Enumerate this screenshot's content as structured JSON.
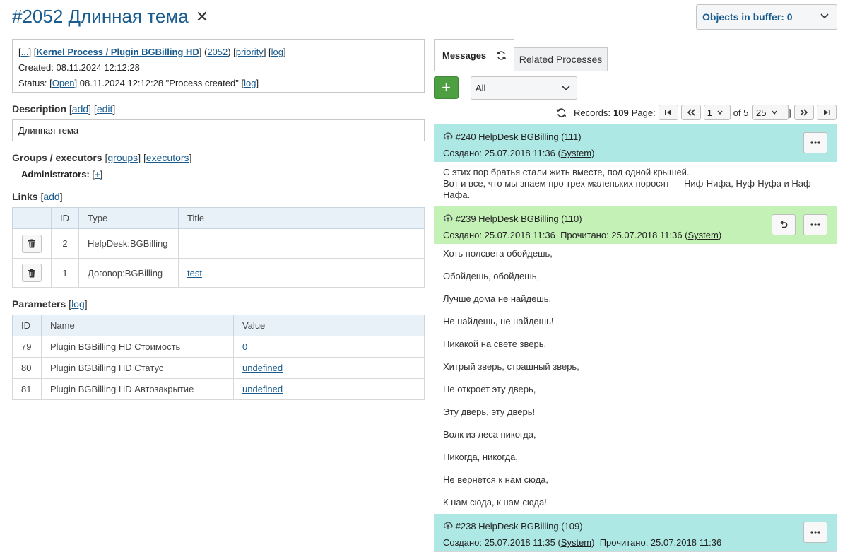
{
  "header": {
    "title": "#2052 Длинная тема",
    "close": "✕"
  },
  "buffer": {
    "label": "Objects in buffer:",
    "count": "0"
  },
  "info": {
    "ellipsis": "...",
    "kernel": "Kernel Process / Plugin BGBilling HD",
    "id_link": "2052",
    "priority": "priority",
    "log": "log",
    "created_label": "Created:",
    "created": "08.11.2024 12:12:28",
    "status_label": "Status:",
    "status": "Open",
    "status_text": "08.11.2024 12:12:28 \"Process created\""
  },
  "description": {
    "title": "Description",
    "add": "add",
    "edit": "edit",
    "value": "Длинная тема"
  },
  "groups": {
    "title": "Groups / executors",
    "groups": "groups",
    "executors": "executors",
    "admins": "Administrators:",
    "plus": "+"
  },
  "links": {
    "title": "Links",
    "add": "add",
    "headers": [
      "ID",
      "Type",
      "Title"
    ],
    "rows": [
      {
        "id": "2",
        "type": "HelpDesk:BGBilling",
        "title": ""
      },
      {
        "id": "1",
        "type": "Договор:BGBilling",
        "title": "test"
      }
    ]
  },
  "parameters": {
    "title": "Parameters",
    "log": "log",
    "headers": [
      "ID",
      "Name",
      "Value"
    ],
    "rows": [
      {
        "id": "79",
        "name": "Plugin BGBilling HD Стоимость",
        "value": "0"
      },
      {
        "id": "80",
        "name": "Plugin BGBilling HD Статус",
        "value": "undefined"
      },
      {
        "id": "81",
        "name": "Plugin BGBilling HD Автозакрытие",
        "value": "undefined"
      }
    ]
  },
  "tabs": {
    "messages": "Messages",
    "related": "Related Processes"
  },
  "toolbar": {
    "add": "+",
    "filter": "All"
  },
  "pager": {
    "records_label": "Records:",
    "records": "109",
    "page_label": "Page:",
    "page": "1",
    "of": "of 5",
    "per_page": "25"
  },
  "messages": [
    {
      "subject": "#240 HelpDesk BGBilling (111)",
      "created": "Создано: 25.07.2018 11:36",
      "user": "System",
      "read": "",
      "lines": [
        "С этих пор братья стали жить вместе, под одной крышей.",
        "Вот и все, что мы знаем про трех маленьких поросят — Ниф-Нифа, Нуф-Нуфа и Наф-",
        "Нафа."
      ]
    },
    {
      "subject": "#239 HelpDesk BGBilling (110)",
      "created": "Создано: 25.07.2018 11:36",
      "read": "Прочитано: 25.07.2018 11:36",
      "user": "System",
      "lines": [
        "Хоть полсвета обойдешь,",
        "Обойдешь, обойдешь,",
        "Лучше дома не найдешь,",
        "Не найдешь, не найдешь!",
        "Никакой на свете зверь,",
        "Хитрый зверь, страшный зверь,",
        "Не откроет эту дверь,",
        "Эту дверь, эту дверь!",
        "Волк из леса никогда,",
        "Никогда, никогда,",
        "Не вернется к нам сюда,",
        "К нам сюда, к нам сюда!"
      ]
    },
    {
      "subject": "#238 HelpDesk BGBilling (109)",
      "created": "Создано: 25.07.2018 11:35",
      "user": "System",
      "read": "Прочитано: 25.07.2018 11:36",
      "lines": []
    }
  ]
}
